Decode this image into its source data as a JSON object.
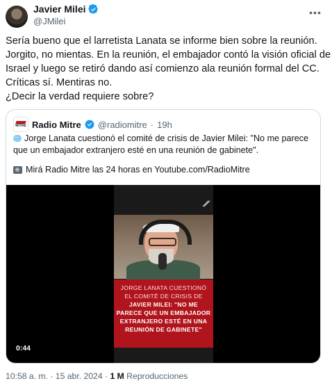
{
  "author": {
    "name": "Javier Milei",
    "handle": "@JMilei"
  },
  "tweet": {
    "lines": [
      "Sería bueno que el larretista Lanata se informe bien sobre la reunión.",
      "Jorgito, no mientas. En la reunión, el embajador contó la visión oficial de",
      "Israel y luego se retiró dando así comienzo ala reunión formal del CC.",
      "Críticas sí. Mentiras no.",
      "¿Decir la verdad requiere sobre?"
    ]
  },
  "quote": {
    "name": "Radio Mitre",
    "handle": "@radiomitre",
    "separator": "·",
    "age": "19h",
    "text_lines": [
      "Jorge Lanata cuestionó el comité de crisis de Javier Milei: \"No me parece",
      "que un embajador extranjero esté en una reunión de gabinete\"."
    ],
    "secondary": "Mirá Radio Mitre las 24 horas en Youtube.com/RadioMitre",
    "video": {
      "duration": "0:44",
      "caption_lines": [
        "JORGE LANATA CUESTIONÓ",
        "EL COMITÉ DE CRISIS DE",
        "JAVIER MILEI: \"NO ME",
        "PARECE QUE UN EMBAJADOR",
        "EXTRANJERO ESTÉ EN UNA",
        "REUNIÓN DE GABINETE\""
      ]
    }
  },
  "footer": {
    "time": "10:58 a. m.",
    "date": "15 abr. 2024",
    "views": "1 M",
    "views_label": "Reproducciones",
    "sep": "·"
  },
  "colors": {
    "verified": "#1d9bf0",
    "caption_bg": "#b0141d",
    "muted": "#536471"
  },
  "icons": [
    "verified-badge-icon",
    "more-options-icon",
    "speech-bubble-emoji-icon",
    "camera-emoji-icon",
    "radio-mitre-logo-icon"
  ]
}
